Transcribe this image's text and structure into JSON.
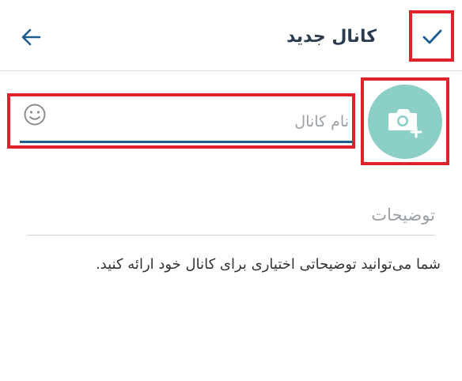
{
  "header": {
    "title": "کانال جدید",
    "back_icon": "arrow-left-icon",
    "confirm_icon": "check-icon"
  },
  "channel": {
    "name_placeholder": "نام کانال",
    "name_value": "",
    "photo_icon": "add-photo-camera-icon",
    "emoji_icon": "smiley-icon"
  },
  "description": {
    "placeholder": "توضیحات",
    "value": "",
    "help_text": "شما می‌توانید توضیحاتی اختیاری برای کانال خود ارائه کنید."
  },
  "colors": {
    "accent": "#1d5c8e",
    "avatar_bg": "#8ccfc6",
    "highlight_box": "#e0232b"
  }
}
